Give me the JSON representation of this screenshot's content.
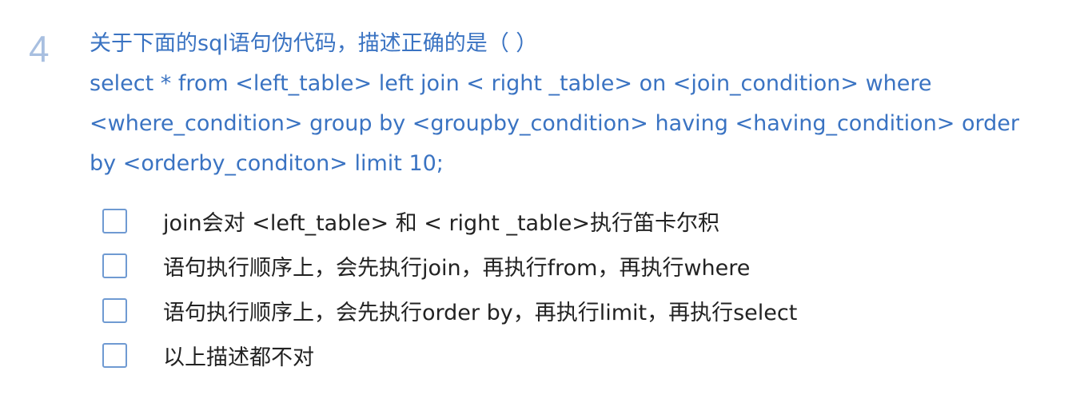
{
  "question": {
    "number": "4",
    "lines": [
      "关于下面的sql语句伪代码，描述正确的是（ ）",
      "select * from <left_table> left join < right _table> on <join_condition> where",
      "<where_condition> group by <groupby_condition> having <having_condition> order",
      "by <orderby_conditon> limit 10;"
    ]
  },
  "options": [
    {
      "label": "join会对 <left_table> 和 < right _table>执行笛卡尔积",
      "checked": false
    },
    {
      "label": "语句执行顺序上，会先执行join，再执行from，再执行where",
      "checked": false
    },
    {
      "label": "语句执行顺序上，会先执行order by，再执行limit，再执行select",
      "checked": false
    },
    {
      "label": "以上描述都不对",
      "checked": false
    }
  ],
  "colors": {
    "question_text": "#3a73c2",
    "question_number": "#a8bfe0",
    "checkbox_border": "#6f9ad2",
    "option_text": "#222222"
  }
}
